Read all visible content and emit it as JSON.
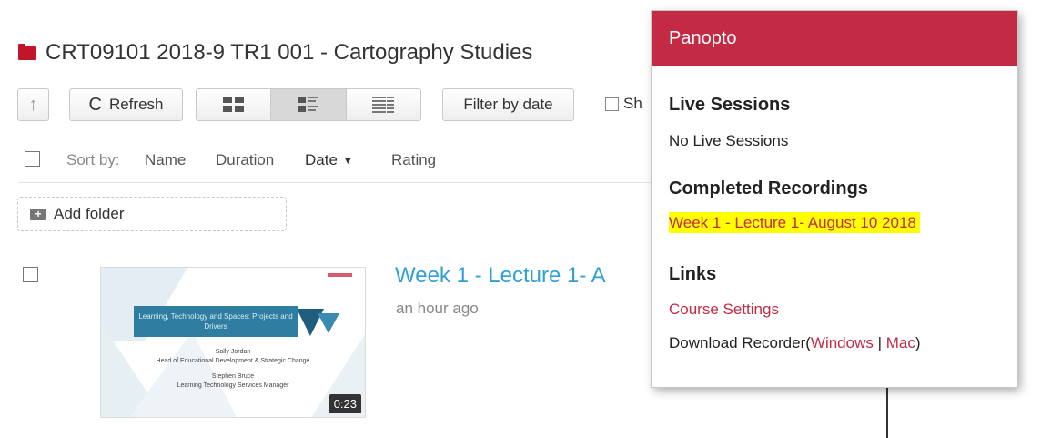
{
  "folder": {
    "title": "CRT09101 2018-9 TR1 001 - Cartography Studies",
    "icon": "folder-icon",
    "icon_color": "#c0152b"
  },
  "toolbar": {
    "up_icon": "↑",
    "refresh_label": "Refresh",
    "refresh_icon": "C",
    "view_modes": [
      "thumbnail-view-icon",
      "detail-view-icon",
      "list-view-icon"
    ],
    "active_view": "detail-view-icon",
    "filter_label": "Filter by date",
    "show_label": "Sh"
  },
  "sort": {
    "label": "Sort by:",
    "options": [
      "Name",
      "Duration",
      "Date",
      "Rating"
    ],
    "active": "Date",
    "direction": "descending"
  },
  "add_folder": {
    "label": "Add folder"
  },
  "video": {
    "title": "Week 1 - Lecture 1- A",
    "time": "an hour ago",
    "duration": "0:23",
    "thumbnail": {
      "banner": "Learning, Technology and Spaces: Projects and Drivers",
      "line1": "Sally Jordan",
      "line2": "Head of Educational Development & Strategic Change",
      "line3": "Stephen Bruce",
      "line4": "Learning Technology Services Manager"
    },
    "title_color": "#2fa0d6"
  },
  "panopto": {
    "header": "Panopto",
    "header_color": "#c22b43",
    "live_heading": "Live Sessions",
    "live_empty": "No Live Sessions",
    "completed_heading": "Completed Recordings",
    "recording_link": "Week 1 - Lecture 1- August 10 2018",
    "highlight_color": "#ffff00",
    "links_heading": "Links",
    "course_settings": "Course Settings",
    "download_prefix": "Download Recorder(",
    "windows_link": "Windows",
    "separator": " | ",
    "mac_link": "Mac",
    "download_suffix": ")"
  }
}
